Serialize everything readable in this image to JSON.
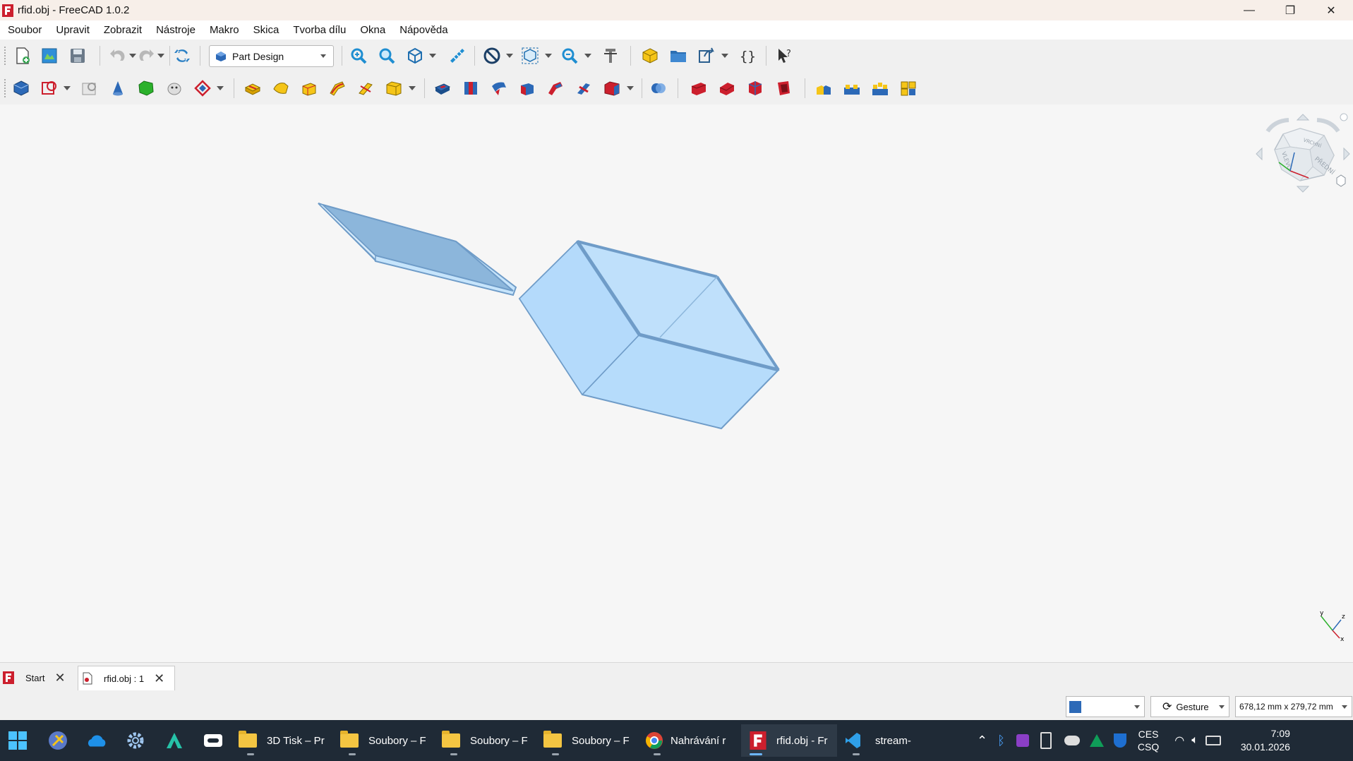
{
  "window": {
    "title": "rfid.obj - FreeCAD 1.0.2",
    "minimize_glyph": "—",
    "maximize_glyph": "❐",
    "close_glyph": "✕"
  },
  "menu": [
    "Soubor",
    "Upravit",
    "Zobrazit",
    "Nástroje",
    "Makro",
    "Skica",
    "Tvorba dílu",
    "Okna",
    "Nápověda"
  ],
  "toolbar": {
    "workbench": "Part Design"
  },
  "navcube": {
    "labels": [
      "VRCHNÍ",
      "PŘEDNÍ",
      "VLEVO"
    ]
  },
  "axis_labels": {
    "x": "x",
    "y": "y",
    "z": "z"
  },
  "doc_tabs": [
    {
      "label": "Start",
      "close": "✕"
    },
    {
      "label": "rfid.obj : 1",
      "close": "✕"
    }
  ],
  "status": {
    "nav_style": "Gesture",
    "dimensions": "678,12 mm x 279,72 mm"
  },
  "taskbar": {
    "apps": [
      {
        "label": "3D Tisk – Pr"
      },
      {
        "label": "Soubory – F"
      },
      {
        "label": "Soubory – F"
      },
      {
        "label": "Soubory – F"
      },
      {
        "label": "Nahrávání r"
      },
      {
        "label": "rfid.obj - Fr"
      },
      {
        "label": "stream-"
      }
    ],
    "language_top": "CES",
    "language_bottom": "CSQ",
    "time": "7:09",
    "date": "30.01.2026"
  },
  "colors": {
    "accent_red": "#cc1f2d",
    "part_yellow": "#f5c518",
    "model_fill": "#b6dcfb",
    "model_edge": "#6f9cc8",
    "taskbar": "#1f2a36"
  }
}
